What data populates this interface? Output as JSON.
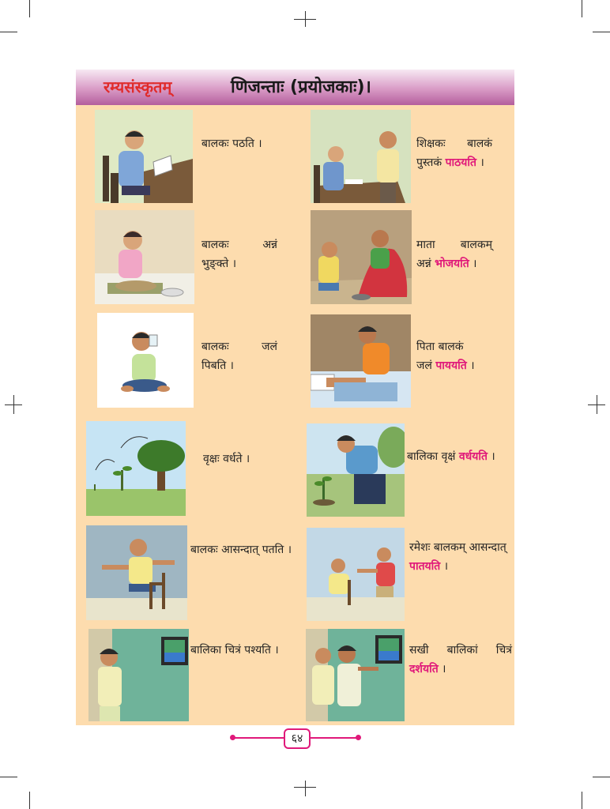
{
  "header": {
    "book_title": "रम्यसंस्कृतम्",
    "chapter_title": "णिजन्ताः (प्रयोजकाः)।"
  },
  "rows": [
    {
      "left": {
        "l1": "बालकः पठति ।"
      },
      "right": {
        "l1": "शिक्षकः बालकं",
        "l2a": "पुस्तकं ",
        "l2v": "पाठयति",
        "l2b": " ।"
      }
    },
    {
      "left": {
        "l1": "बालकः अन्नं",
        "l2": "भुङ्क्ते ।"
      },
      "right": {
        "l1": "माता बालकम्",
        "l2a": "अन्नं ",
        "l2v": "भोजयति",
        "l2b": " ।"
      }
    },
    {
      "left": {
        "l1": "बालकः जलं",
        "l2": "पिबति ।"
      },
      "right": {
        "l1": "पिता बालकं",
        "l2a": "जलं ",
        "l2v": "पाययति",
        "l2b": " ।"
      }
    },
    {
      "left": {
        "l1": "वृक्षः वर्धते ।"
      },
      "right": {
        "l1a": "बालिका वृक्षं ",
        "l1v": "वर्धयति",
        "l1b": " ।"
      }
    },
    {
      "left": {
        "l1": "बालकः आसन्दात् पतति ।"
      },
      "right": {
        "l1": "रमेशः बालकम् आसन्दात्",
        "l2v": "पातयति",
        "l2b": " ।"
      }
    },
    {
      "left": {
        "l1": "बालिका चित्रं पश्यति ।"
      },
      "right": {
        "l1": "सखी बालिकां चित्रं",
        "l2v": "दर्शयति",
        "l2b": " ।"
      }
    }
  ],
  "footer": {
    "page_number": "६४"
  },
  "colors": {
    "page_bg": "#fddcae",
    "header_band": "#b45e9d",
    "book_title": "#e02b2b",
    "highlight_verb": "#e0197a"
  }
}
